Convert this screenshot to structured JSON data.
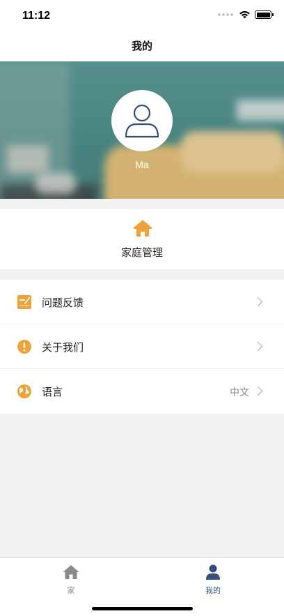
{
  "status_bar": {
    "time": "11:12"
  },
  "nav": {
    "title": "我的"
  },
  "profile": {
    "name": "Ma",
    "avatar_icon": "user-outline-icon"
  },
  "family": {
    "label": "家庭管理",
    "icon": "home-icon"
  },
  "menu": {
    "items": [
      {
        "label": "问题反馈",
        "icon": "feedback-icon",
        "value": ""
      },
      {
        "label": "关于我们",
        "icon": "info-icon",
        "value": ""
      },
      {
        "label": "语言",
        "icon": "globe-icon",
        "value": "中文"
      }
    ]
  },
  "tab_bar": {
    "home_label": "家",
    "mine_label": "我的",
    "active": "我的"
  },
  "colors": {
    "accent_orange": "#f0a23a",
    "active_tab": "#34507d",
    "inactive_tab": "#8a8a8a",
    "banner_teal": "#5e9c99"
  }
}
